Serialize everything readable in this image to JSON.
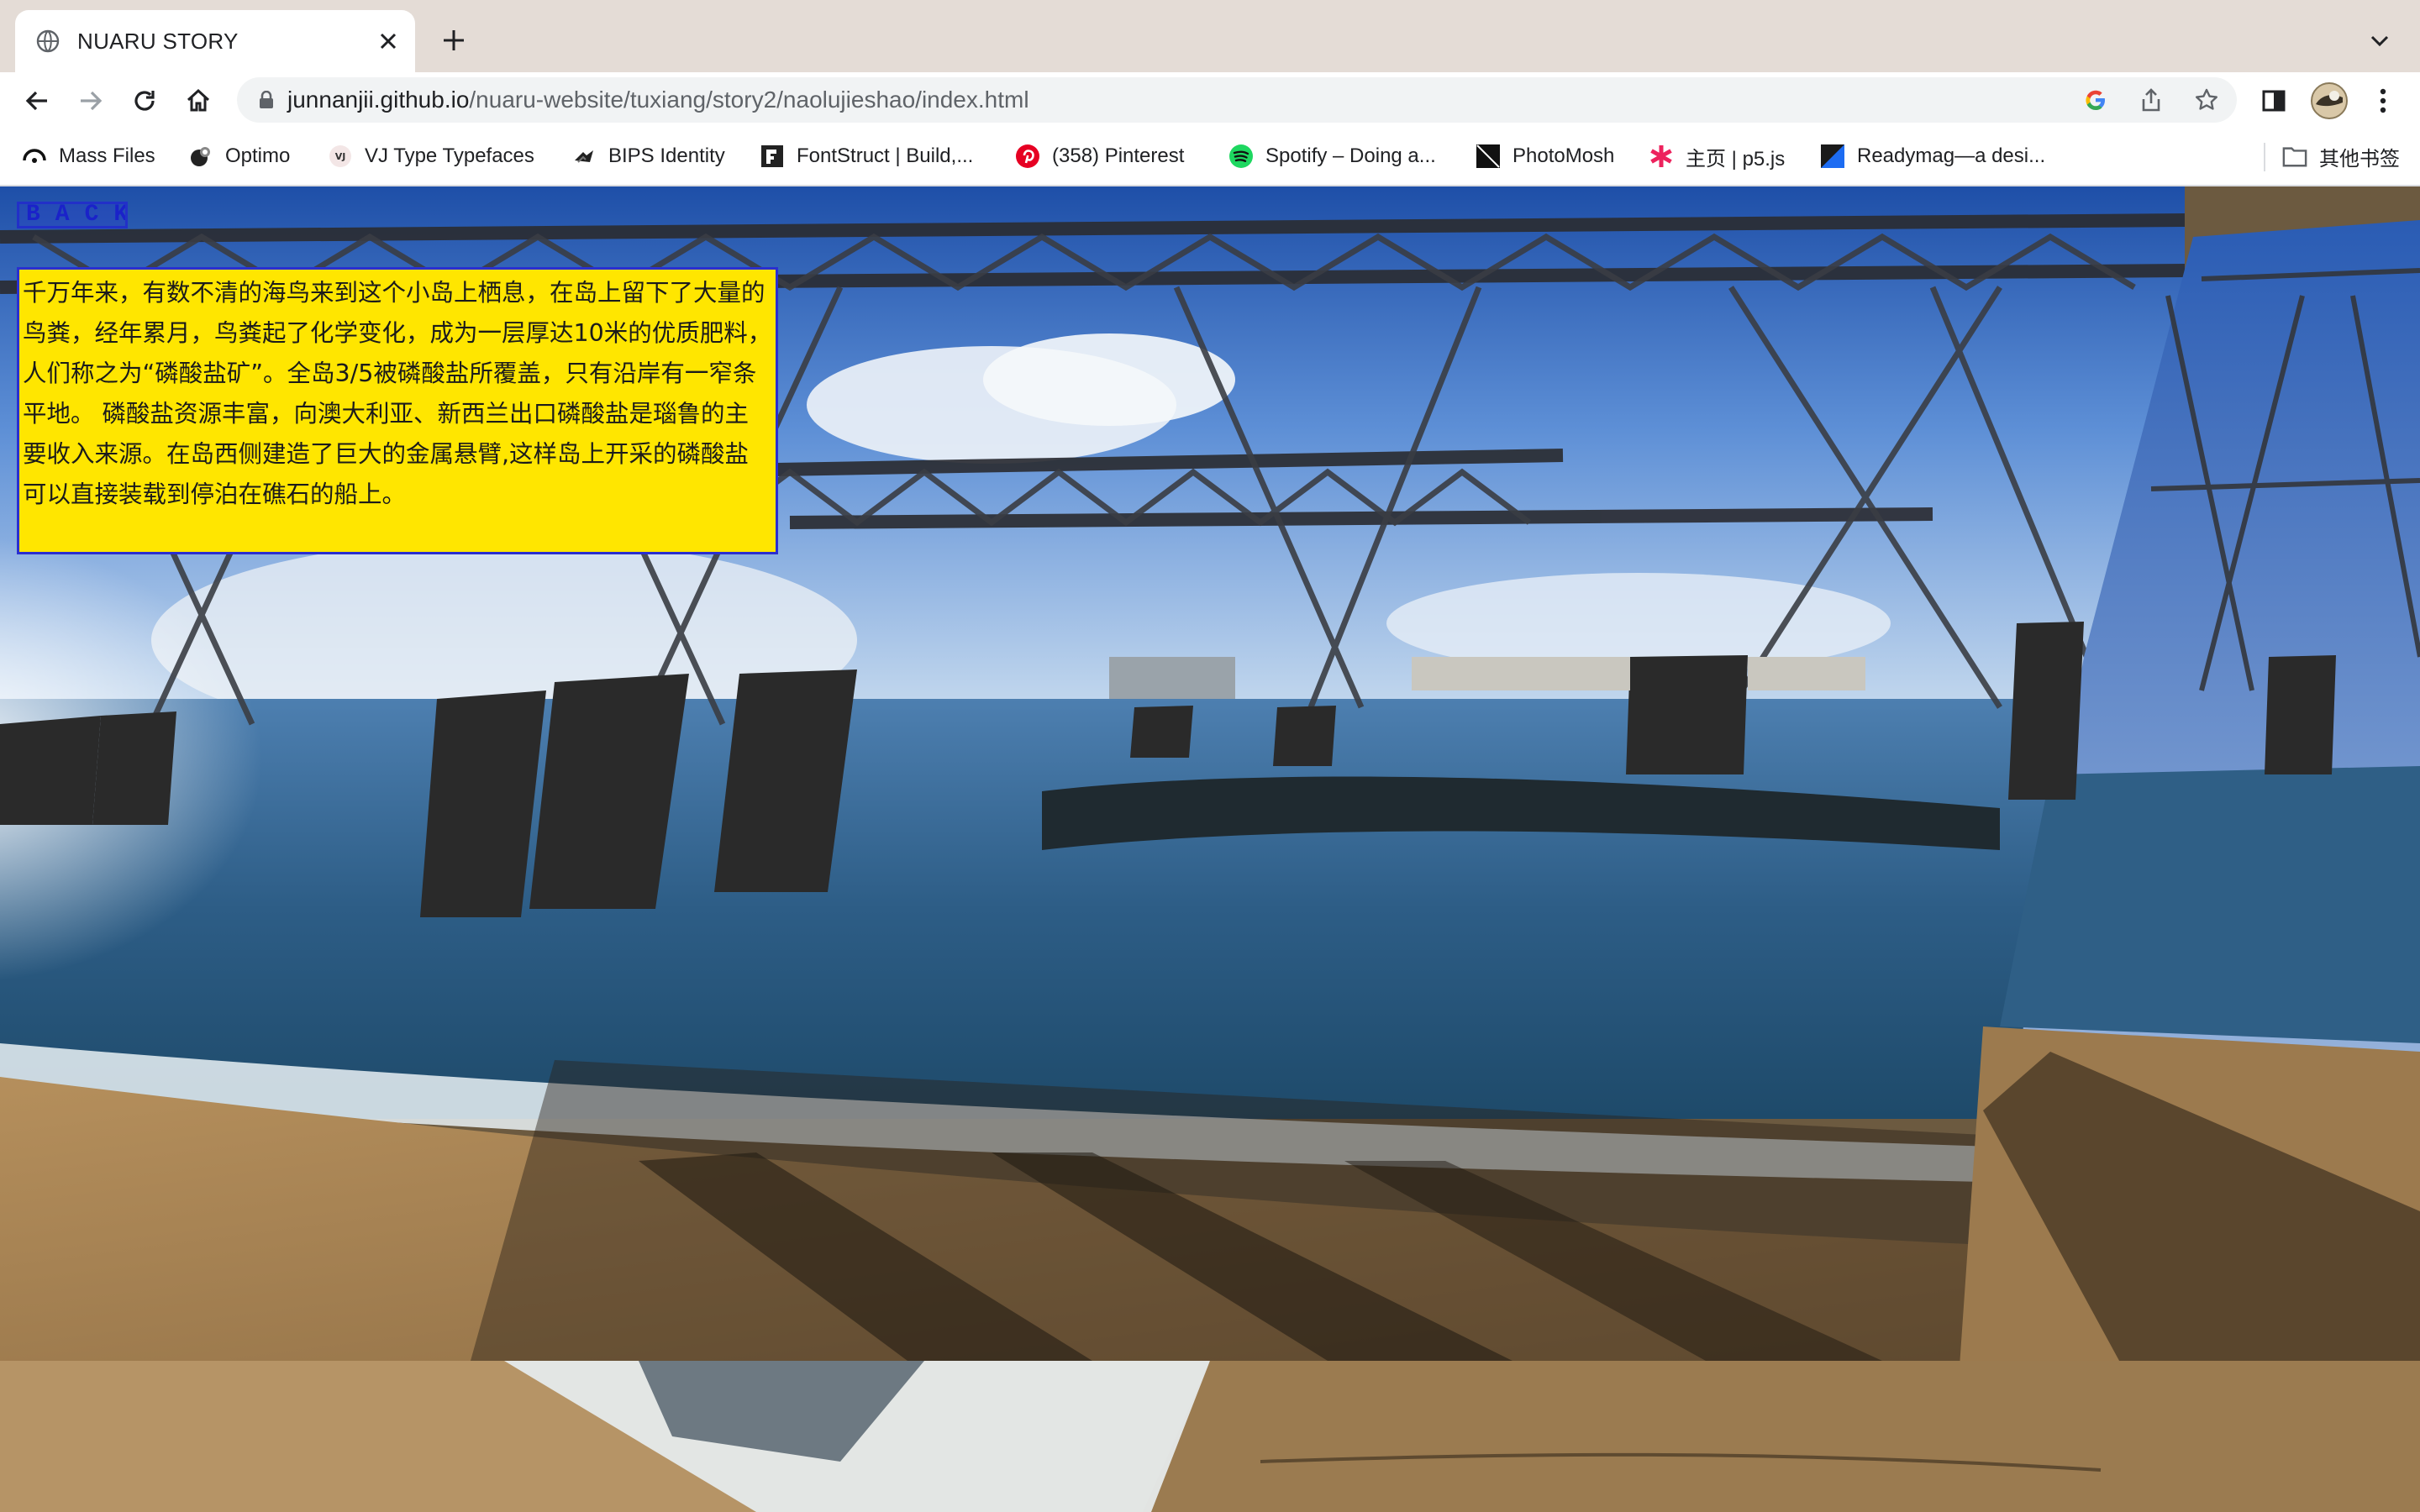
{
  "browser": {
    "tab": {
      "title": "NUARU STORY",
      "favicon": "globe-icon"
    },
    "url": {
      "host": "junnanjii.github.io",
      "path": "/nuaru-website/tuxiang/story2/naolujieshao/index.html"
    },
    "bookmarks": [
      {
        "label": "Mass Files",
        "icon": "arc-icon"
      },
      {
        "label": "Optimo",
        "icon": "optimo-icon"
      },
      {
        "label": "VJ Type Typefaces",
        "icon": "vj-icon"
      },
      {
        "label": "BIPS Identity",
        "icon": "bips-icon"
      },
      {
        "label": "FontStruct | Build,...",
        "icon": "fontstruct-icon"
      },
      {
        "label": "(358) Pinterest",
        "icon": "pinterest-icon"
      },
      {
        "label": "Spotify – Doing a...",
        "icon": "spotify-icon"
      },
      {
        "label": "PhotoMosh",
        "icon": "photomosh-icon"
      },
      {
        "label": "主页 | p5.js",
        "icon": "p5-asterisk-icon"
      },
      {
        "label": "Readymag—a desi...",
        "icon": "readymag-icon"
      }
    ],
    "other_bookmarks": "其他书签"
  },
  "page": {
    "back_label": "BACK",
    "story_text": "千万年来，有数不清的海鸟来到这个小岛上栖息，在岛上留下了大量的鸟粪，经年累月，鸟粪起了化学变化，成为一层厚达10米的优质肥料，人们称之为“磷酸盐矿”。全岛3/5被磷酸盐所覆盖，只有沿岸有一窄条平地。 磷酸盐资源丰富，向澳大利亚、新西兰出口磷酸盐是瑙鲁的主要收入来源。在岛西侧建造了巨大的金属悬臂,这样岛上开采的磷酸盐可以直接装载到停泊在礁石的船上。",
    "colors": {
      "panel": "#ffe600",
      "accent": "#2a2fd0"
    }
  }
}
